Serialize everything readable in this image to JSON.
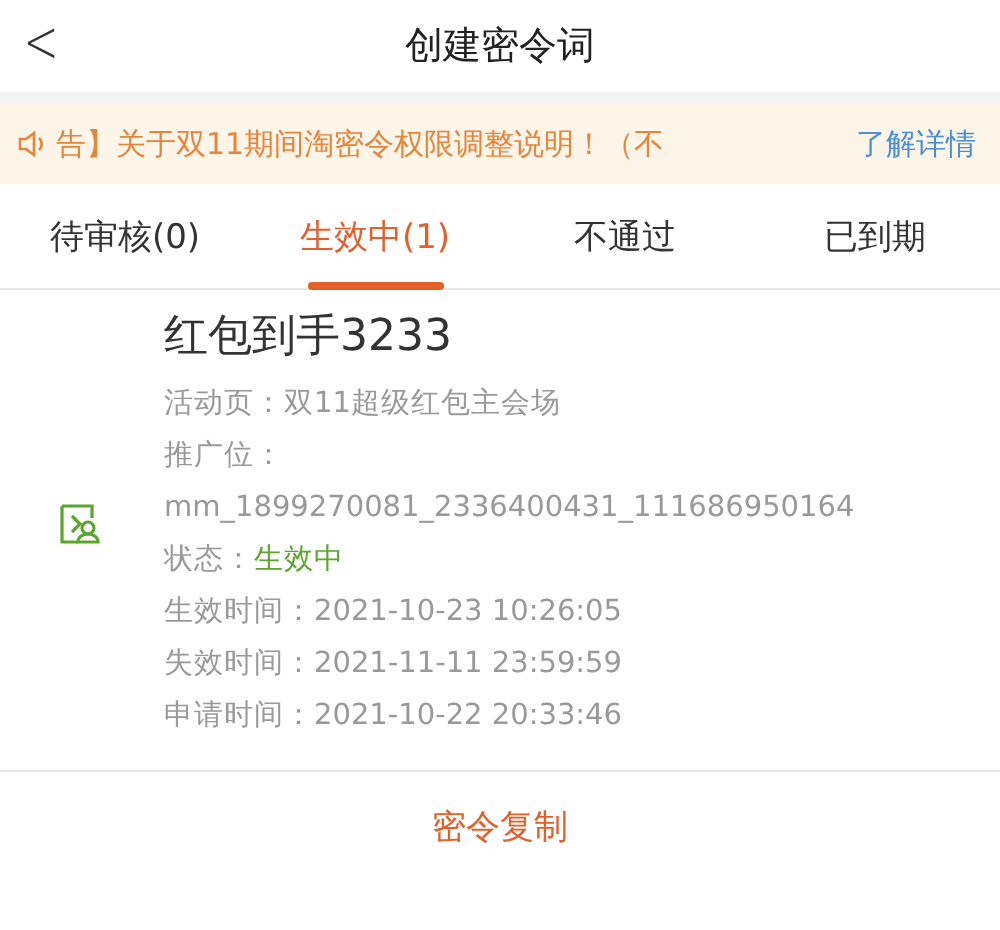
{
  "header": {
    "back": "<",
    "title": "创建密令词"
  },
  "notice": {
    "text": "告】关于双11期间淘密令权限调整说明！（不",
    "link": "了解详情"
  },
  "tabs": [
    {
      "label": "待审核(0)",
      "selected": false
    },
    {
      "label": "生效中(1)",
      "selected": true
    },
    {
      "label": "不通过",
      "selected": false
    },
    {
      "label": "已到期",
      "selected": false
    }
  ],
  "card": {
    "title": "红包到手3233",
    "lines": [
      {
        "kind": "plain",
        "text": "活动页：双11超级红包主会场"
      },
      {
        "kind": "plain",
        "text": "推广位："
      },
      {
        "kind": "plain",
        "text": "mm_1899270081_2336400431_111686950164"
      },
      {
        "kind": "status",
        "label": "状态：",
        "value": "生效中"
      },
      {
        "kind": "plain",
        "text": "生效时间：2021-10-23 10:26:05"
      },
      {
        "kind": "plain",
        "text": "失效时间：2021-11-11 23:59:59"
      },
      {
        "kind": "plain",
        "text": "申请时间：2021-10-22 20:33:46"
      }
    ]
  },
  "action": "密令复制"
}
